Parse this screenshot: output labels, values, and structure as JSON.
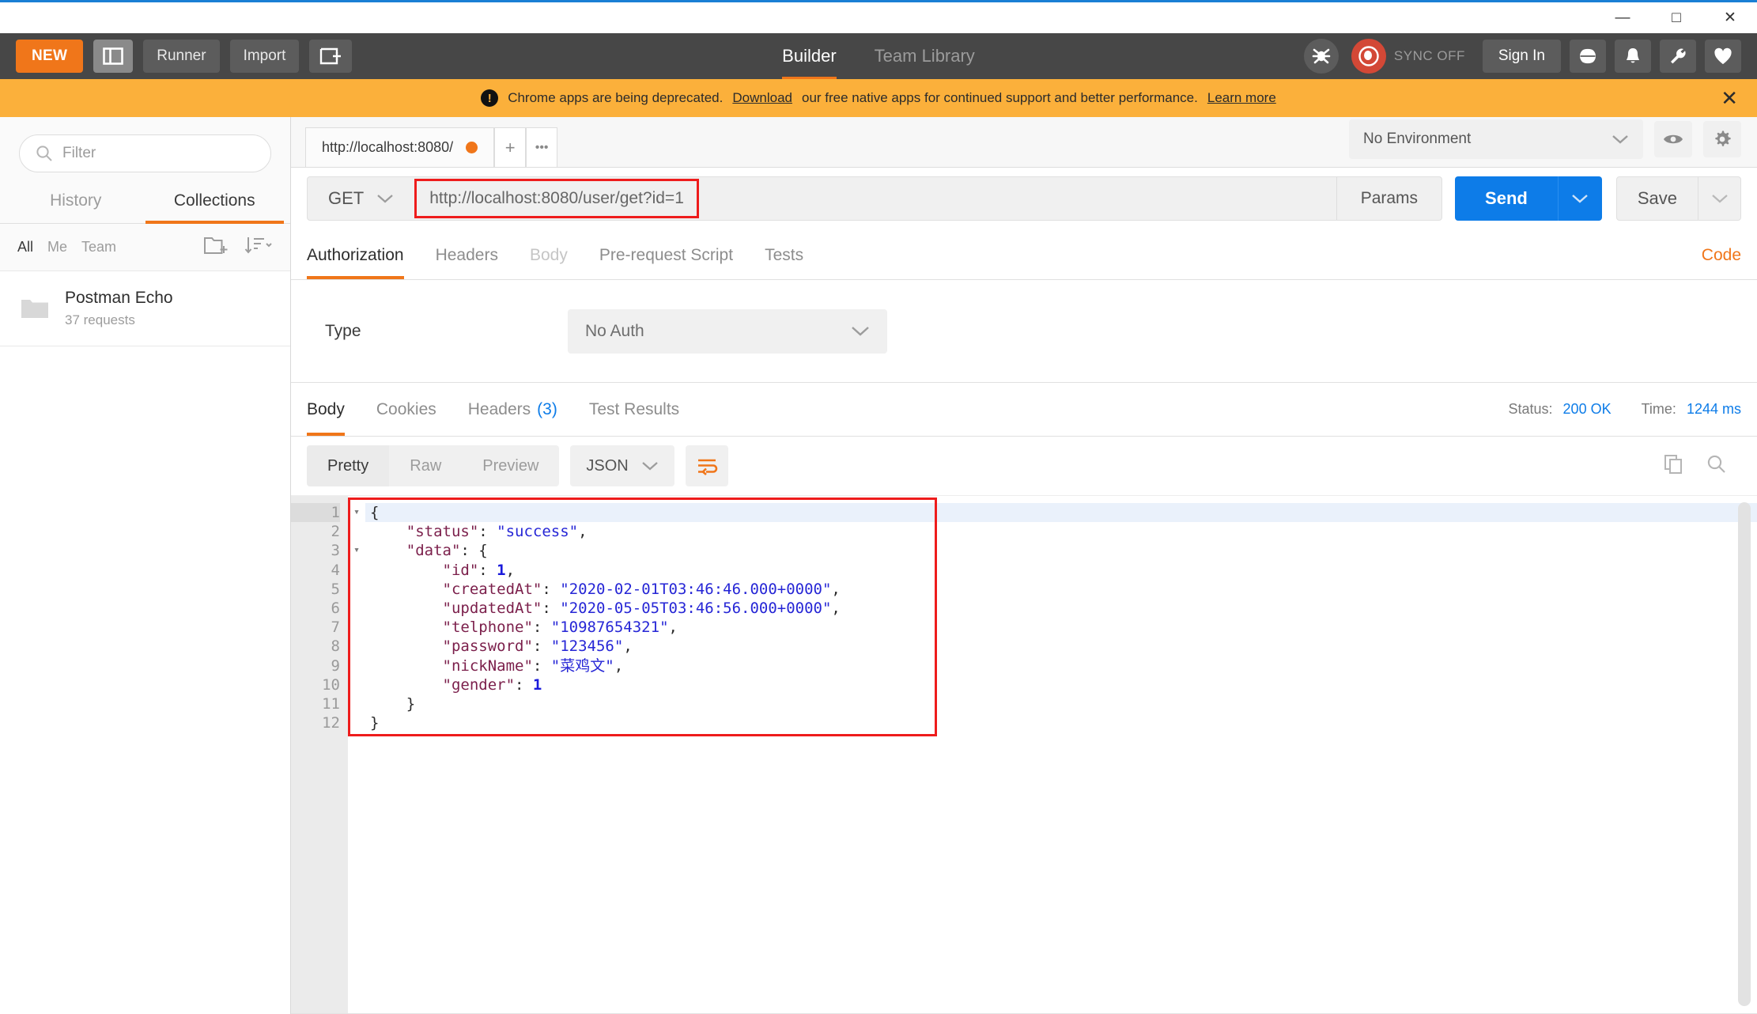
{
  "window": {
    "minimize_label": "—",
    "maximize_label": "□",
    "close_label": "✕"
  },
  "header": {
    "new_label": "NEW",
    "sidebar_toggle_name": "sidebar-toggle",
    "runner_label": "Runner",
    "import_label": "Import",
    "new_tab_name": "new-tab-icon",
    "tabs": [
      {
        "label": "Builder",
        "active": true
      },
      {
        "label": "Team Library",
        "active": false
      }
    ],
    "bug_icon": "bug-icon",
    "sync_label": "SYNC OFF",
    "sign_in_label": "Sign In",
    "globe_icon": "globe-icon",
    "bell_icon": "bell-icon",
    "wrench_icon": "wrench-icon",
    "heart_icon": "heart-icon"
  },
  "banner": {
    "warning_icon": "!",
    "text_before": "Chrome apps are being deprecated.",
    "link_download": "Download",
    "text_middle": "our free native apps for continued support and better performance.",
    "link_learn_more": "Learn more",
    "close_label": "✕",
    "background": "#fbb03b"
  },
  "sidebar": {
    "filter_placeholder": "Filter",
    "search_icon": "search-icon",
    "tabs": [
      {
        "label": "History",
        "active": false
      },
      {
        "label": "Collections",
        "active": true
      }
    ],
    "scope_filters": [
      {
        "label": "All",
        "active": true
      },
      {
        "label": "Me",
        "active": false
      },
      {
        "label": "Team",
        "active": false
      }
    ],
    "new_folder_icon": "new-folder-icon",
    "sort_icon": "sort-icon",
    "collections": [
      {
        "name": "Postman Echo",
        "meta": "37 requests",
        "icon": "folder-icon"
      }
    ]
  },
  "request_tabs": {
    "items": [
      {
        "label": "http://localhost:8080/",
        "unsaved": true
      }
    ],
    "add_label": "+",
    "more_label": "•••"
  },
  "environment": {
    "selected": "No Environment",
    "caret": "⌄",
    "eye_icon": "eye-icon",
    "gear_icon": "gear-icon"
  },
  "request": {
    "method": "GET",
    "method_caret": "⌄",
    "url": "http://localhost:8080/user/get?id=1",
    "params_label": "Params",
    "send_label": "Send",
    "send_caret": "⌄",
    "save_label": "Save",
    "save_caret": "⌄",
    "highlight_color": "#ee1c1c",
    "send_color": "#0d7ce8"
  },
  "request_tabs_sub": {
    "items": [
      {
        "label": "Authorization",
        "active": true,
        "dim": false
      },
      {
        "label": "Headers",
        "active": false,
        "dim": false
      },
      {
        "label": "Body",
        "active": false,
        "dim": true
      },
      {
        "label": "Pre-request Script",
        "active": false,
        "dim": false
      },
      {
        "label": "Tests",
        "active": false,
        "dim": false
      }
    ],
    "code_label": "Code"
  },
  "authorization": {
    "type_label": "Type",
    "type_value": "No Auth",
    "caret": "⌄"
  },
  "response": {
    "tabs": [
      {
        "label": "Body",
        "active": true,
        "count": ""
      },
      {
        "label": "Cookies",
        "active": false,
        "count": ""
      },
      {
        "label": "Headers",
        "active": false,
        "count": "(3)"
      },
      {
        "label": "Test Results",
        "active": false,
        "count": ""
      }
    ],
    "status_key": "Status:",
    "status_value": "200 OK",
    "time_key": "Time:",
    "time_value": "1244 ms",
    "view_modes": [
      {
        "label": "Pretty",
        "active": true
      },
      {
        "label": "Raw",
        "active": false
      },
      {
        "label": "Preview",
        "active": false
      }
    ],
    "format": "JSON",
    "format_caret": "⌄",
    "wrap_icon": "word-wrap-icon",
    "copy_icon": "copy-icon",
    "search_icon": "search-icon",
    "line_numbers": [
      "1",
      "2",
      "3",
      "4",
      "5",
      "6",
      "7",
      "8",
      "9",
      "10",
      "11",
      "12"
    ],
    "body_json": {
      "status": "success",
      "data": {
        "id": 1,
        "createdAt": "2020-02-01T03:46:46.000+0000",
        "updatedAt": "2020-05-05T03:46:56.000+0000",
        "telphone": "10987654321",
        "password": "123456",
        "nickName": "菜鸡文",
        "gender": 1
      }
    },
    "body_lines": [
      {
        "n": 1,
        "fold": "▾",
        "tokens": [
          {
            "t": "{",
            "c": "p"
          }
        ]
      },
      {
        "n": 2,
        "fold": "",
        "tokens": [
          {
            "t": "    ",
            "c": "p"
          },
          {
            "t": "\"status\"",
            "c": "k"
          },
          {
            "t": ": ",
            "c": "p"
          },
          {
            "t": "\"success\"",
            "c": "s"
          },
          {
            "t": ",",
            "c": "p"
          }
        ]
      },
      {
        "n": 3,
        "fold": "▾",
        "tokens": [
          {
            "t": "    ",
            "c": "p"
          },
          {
            "t": "\"data\"",
            "c": "k"
          },
          {
            "t": ": ",
            "c": "p"
          },
          {
            "t": "{",
            "c": "p"
          }
        ]
      },
      {
        "n": 4,
        "fold": "",
        "tokens": [
          {
            "t": "        ",
            "c": "p"
          },
          {
            "t": "\"id\"",
            "c": "k"
          },
          {
            "t": ": ",
            "c": "p"
          },
          {
            "t": "1",
            "c": "n"
          },
          {
            "t": ",",
            "c": "p"
          }
        ]
      },
      {
        "n": 5,
        "fold": "",
        "tokens": [
          {
            "t": "        ",
            "c": "p"
          },
          {
            "t": "\"createdAt\"",
            "c": "k"
          },
          {
            "t": ": ",
            "c": "p"
          },
          {
            "t": "\"2020-02-01T03:46:46.000+0000\"",
            "c": "s"
          },
          {
            "t": ",",
            "c": "p"
          }
        ]
      },
      {
        "n": 6,
        "fold": "",
        "tokens": [
          {
            "t": "        ",
            "c": "p"
          },
          {
            "t": "\"updatedAt\"",
            "c": "k"
          },
          {
            "t": ": ",
            "c": "p"
          },
          {
            "t": "\"2020-05-05T03:46:56.000+0000\"",
            "c": "s"
          },
          {
            "t": ",",
            "c": "p"
          }
        ]
      },
      {
        "n": 7,
        "fold": "",
        "tokens": [
          {
            "t": "        ",
            "c": "p"
          },
          {
            "t": "\"telphone\"",
            "c": "k"
          },
          {
            "t": ": ",
            "c": "p"
          },
          {
            "t": "\"10987654321\"",
            "c": "s"
          },
          {
            "t": ",",
            "c": "p"
          }
        ]
      },
      {
        "n": 8,
        "fold": "",
        "tokens": [
          {
            "t": "        ",
            "c": "p"
          },
          {
            "t": "\"password\"",
            "c": "k"
          },
          {
            "t": ": ",
            "c": "p"
          },
          {
            "t": "\"123456\"",
            "c": "s"
          },
          {
            "t": ",",
            "c": "p"
          }
        ]
      },
      {
        "n": 9,
        "fold": "",
        "tokens": [
          {
            "t": "        ",
            "c": "p"
          },
          {
            "t": "\"nickName\"",
            "c": "k"
          },
          {
            "t": ": ",
            "c": "p"
          },
          {
            "t": "\"菜鸡文\"",
            "c": "s"
          },
          {
            "t": ",",
            "c": "p"
          }
        ]
      },
      {
        "n": 10,
        "fold": "",
        "tokens": [
          {
            "t": "        ",
            "c": "p"
          },
          {
            "t": "\"gender\"",
            "c": "k"
          },
          {
            "t": ": ",
            "c": "p"
          },
          {
            "t": "1",
            "c": "n"
          }
        ]
      },
      {
        "n": 11,
        "fold": "",
        "tokens": [
          {
            "t": "    }",
            "c": "p"
          }
        ]
      },
      {
        "n": 12,
        "fold": "",
        "tokens": [
          {
            "t": "}",
            "c": "p"
          }
        ]
      }
    ]
  }
}
